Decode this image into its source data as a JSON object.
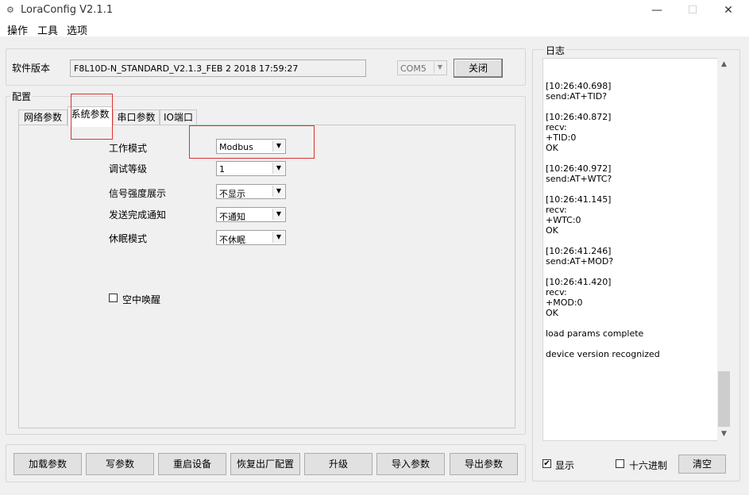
{
  "window": {
    "title": "LoraConfig V2.1.1",
    "minimize_glyph": "—",
    "maximize_glyph": "☐",
    "close_glyph": "✕"
  },
  "menu": {
    "items": [
      "操作",
      "工具",
      "选项"
    ]
  },
  "version": {
    "label": "软件版本",
    "value": "F8L10D-N_STANDARD_V2.1.3_FEB  2 2018 17:59:27",
    "port": "COM5",
    "close_label": "关闭"
  },
  "config": {
    "group_label": "配置",
    "tabs": [
      "网络参数",
      "系统参数",
      "串口参数",
      "IO端口"
    ],
    "active_tab": 1,
    "fields": [
      {
        "label": "工作模式",
        "value": "Modbus"
      },
      {
        "label": "调试等级",
        "value": "1"
      },
      {
        "label": "信号强度展示",
        "value": "不显示"
      },
      {
        "label": "发送完成通知",
        "value": "不通知"
      },
      {
        "label": "休眠模式",
        "value": "不休眠"
      }
    ],
    "air_wakeup": {
      "label": "空中唤醒",
      "checked": false
    }
  },
  "actions": [
    "加载参数",
    "写参数",
    "重启设备",
    "恢复出厂配置",
    "升级",
    "导入参数",
    "导出参数"
  ],
  "log": {
    "title": "日志",
    "entries": [
      [
        "[10:26:40.698]",
        "send:AT+TID?"
      ],
      [
        "[10:26:40.872]",
        "recv:",
        " +TID:0",
        "OK"
      ],
      [
        "[10:26:40.972]",
        "send:AT+WTC?"
      ],
      [
        "[10:26:41.145]",
        "recv:",
        " +WTC:0",
        "OK"
      ],
      [
        "[10:26:41.246]",
        "send:AT+MOD?"
      ],
      [
        "[10:26:41.420]",
        "recv:",
        " +MOD:0",
        "OK"
      ],
      [
        "load params complete"
      ],
      [
        "device version recognized"
      ]
    ],
    "show_label": "显示",
    "show_checked": true,
    "hex_label": "十六进制",
    "hex_checked": false,
    "clear_label": "清空"
  },
  "icons": {
    "check": "✔",
    "dropdown": "▼",
    "scroll_up": "▲",
    "scroll_down": "▼"
  }
}
